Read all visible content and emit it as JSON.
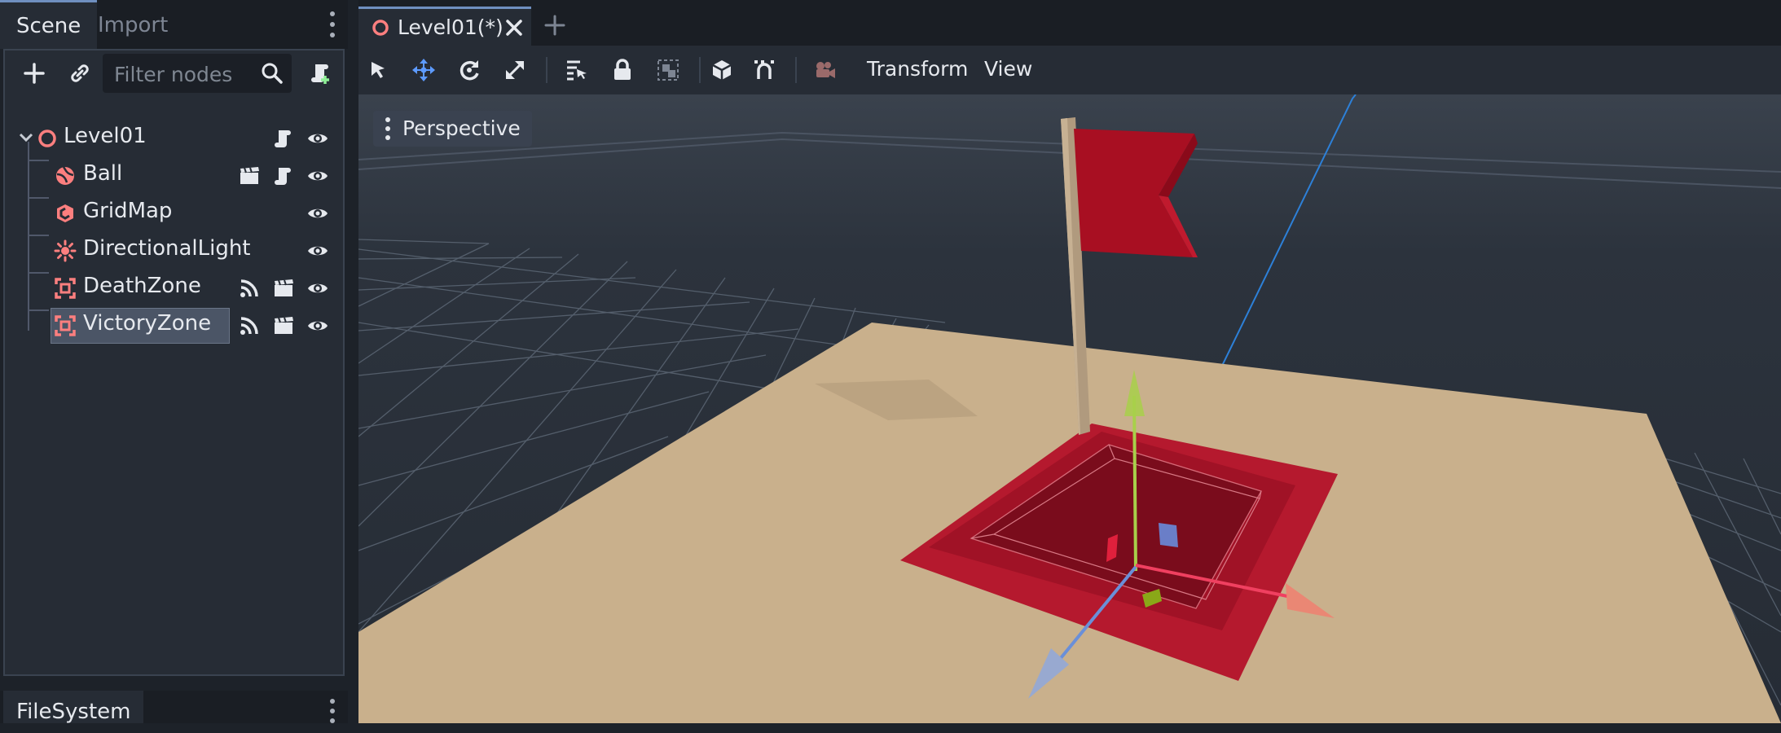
{
  "left_dock": {
    "tabs": [
      "Scene",
      "Import"
    ],
    "filter_placeholder": "Filter nodes",
    "tree": [
      {
        "label": "Level01",
        "icon": "node3d-icon"
      },
      {
        "label": "Ball",
        "icon": "rigidbody-icon"
      },
      {
        "label": "GridMap",
        "icon": "gridmap-icon"
      },
      {
        "label": "DirectionalLight",
        "icon": "light-icon"
      },
      {
        "label": "DeathZone",
        "icon": "area-icon"
      },
      {
        "label": "VictoryZone",
        "icon": "area-icon",
        "selected": true
      }
    ],
    "filesystem_tab": "FileSystem"
  },
  "main": {
    "scene_tab": "Level01(*)",
    "toolbar_menus": [
      "Transform",
      "View"
    ],
    "viewport_mode": "Perspective"
  },
  "colors": {
    "accent": "#6f8fbf",
    "node_icon": "#fc7f7f",
    "axis_x": "#f04060",
    "axis_y": "#a8d04a",
    "axis_z": "#6a8fd8"
  }
}
